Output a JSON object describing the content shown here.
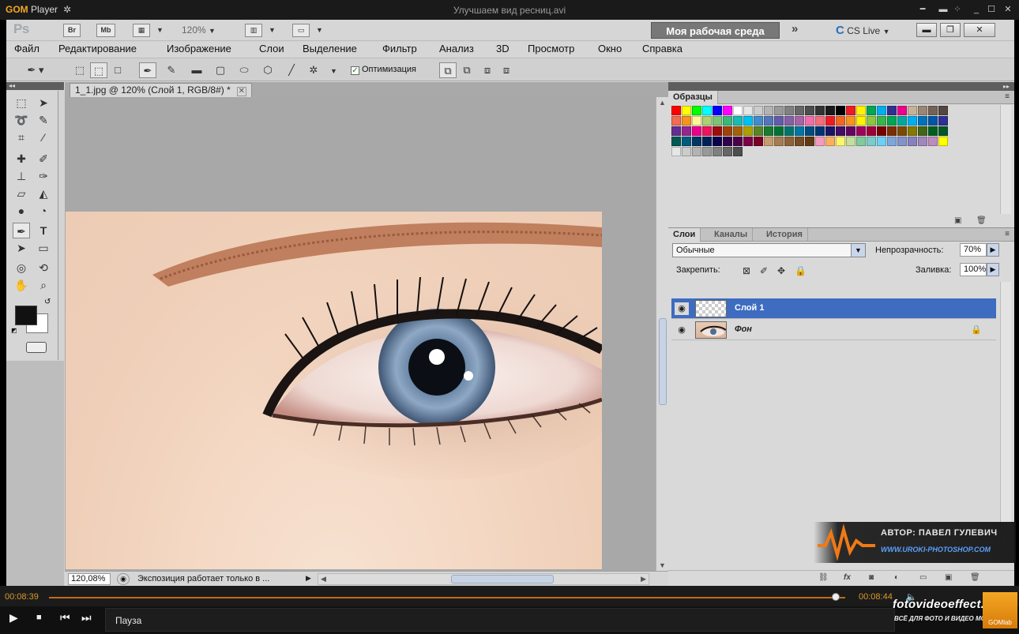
{
  "gom": {
    "logo_brand": "GOM",
    "logo_product": "Player",
    "file_title": "Улучшаем вид ресниц.avi",
    "time_elapsed": "00:08:39",
    "time_total": "00:08:44",
    "status": "Пауза",
    "progress_percent": 98.8,
    "badge": "GOMlab"
  },
  "photoshop": {
    "logo": "Ps",
    "appbar": {
      "br": "Br",
      "mb": "Mb",
      "zoom": "120%",
      "workspace": "Моя рабочая среда",
      "cs_live": "CS Live"
    },
    "menu": [
      "Файл",
      "Редактирование",
      "Изображение",
      "Слои",
      "Выделение",
      "Фильтр",
      "Анализ",
      "3D",
      "Просмотр",
      "Окно",
      "Справка"
    ],
    "options": {
      "optimization_label": "Оптимизация",
      "optimization_checked": true
    },
    "document": {
      "tab_title": "1_1.jpg @ 120% (Слой 1, RGB/8#) *",
      "zoom_value": "120,08%",
      "status_text": "Экспозиция работает только в ..."
    },
    "swatches_panel": {
      "title": "Образцы",
      "colors": [
        "#ff0000",
        "#ffff00",
        "#00ff00",
        "#00ffff",
        "#0000ff",
        "#ff00ff",
        "#ffffff",
        "#e6e6e6",
        "#cccccc",
        "#b3b3b3",
        "#999999",
        "#808080",
        "#666666",
        "#4d4d4d",
        "#333333",
        "#1a1a1a",
        "#000000",
        "#ed1c24",
        "#fff200",
        "#00a651",
        "#00aeef",
        "#2e3192",
        "#ec008c",
        "#c7b299",
        "#998675",
        "#736357",
        "#534741",
        "#f26c4f",
        "#f7941d",
        "#fff799",
        "#acd373",
        "#7cc576",
        "#3bb878",
        "#1abbb4",
        "#00bff3",
        "#438ccb",
        "#5574b9",
        "#605ca8",
        "#855fa8",
        "#a763a8",
        "#f06eaa",
        "#f26d7d",
        "#ed1c24",
        "#f26522",
        "#f7941d",
        "#fff200",
        "#8dc63f",
        "#39b54a",
        "#00a651",
        "#00a99d",
        "#00aeef",
        "#0072bc",
        "#0054a6",
        "#2e3192",
        "#662d91",
        "#92278f",
        "#ec008c",
        "#ed145b",
        "#9e0b0f",
        "#a0410d",
        "#a36209",
        "#aba000",
        "#598527",
        "#197b30",
        "#007236",
        "#00746b",
        "#0076a3",
        "#004b80",
        "#003471",
        "#1b1464",
        "#440e62",
        "#630460",
        "#9e005d",
        "#9e0039",
        "#790000",
        "#7b2e00",
        "#7d4900",
        "#827b00",
        "#406618",
        "#005e20",
        "#005826",
        "#005952",
        "#005b7f",
        "#003663",
        "#002157",
        "#0d004c",
        "#32004b",
        "#4b0049",
        "#7b0046",
        "#7a0026",
        "#c69c6d",
        "#a67c52",
        "#8c6239",
        "#754c24",
        "#603913",
        "#f49ac1",
        "#fbaf5d",
        "#fff568",
        "#c4df9b",
        "#82ca9c",
        "#7accc8",
        "#6dcff6",
        "#7da7d9",
        "#8393ca",
        "#8781bd",
        "#a186be",
        "#bd8cbf",
        "#ffff00",
        "#e6e6e6",
        "#cccccc",
        "#b3b3b3",
        "#999999",
        "#808080",
        "#666666",
        "#4d4d4d"
      ]
    },
    "layers_panel": {
      "tabs": [
        "Слои",
        "Каналы",
        "История"
      ],
      "blend_mode": "Обычные",
      "opacity_label": "Непрозрачность:",
      "opacity_value": "70%",
      "lock_label": "Закрепить:",
      "fill_label": "Заливка:",
      "fill_value": "100%",
      "layers": [
        {
          "name": "Слой 1",
          "selected": true,
          "visible": true
        },
        {
          "name": "Фон",
          "selected": false,
          "visible": true,
          "locked": true
        }
      ]
    }
  },
  "watermark": {
    "author": "АВТОР: ПАВЕЛ ГУЛЕВИЧ",
    "url": "WWW.UROKI-PHOTOSHOP.COM"
  },
  "branding": {
    "site": "fotovideoeffect.com",
    "tagline": "ВСЁ ДЛЯ ФОТО И ВИДЕО МОНТАЖА!"
  }
}
